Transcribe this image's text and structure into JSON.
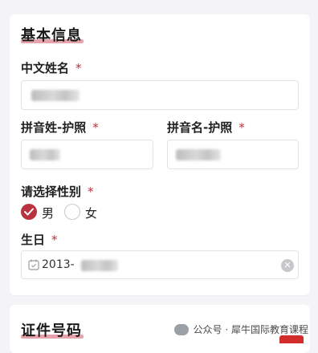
{
  "basic_info": {
    "title": "基本信息",
    "chinese_name": {
      "label": "中文姓名",
      "required": "*"
    },
    "pinyin_surname": {
      "label": "拼音姓-护照",
      "required": "*"
    },
    "pinyin_given": {
      "label": "拼音名-护照",
      "required": "*"
    },
    "gender": {
      "label": "请选择性别",
      "required": "*",
      "options": [
        "男",
        "女"
      ],
      "selected": "男"
    },
    "birthday": {
      "label": "生日",
      "required": "*",
      "value": "2013-"
    }
  },
  "id_section": {
    "title": "证件号码"
  },
  "watermark": {
    "text": "公众号 · 犀牛国际教育课程"
  },
  "colors": {
    "accent": "#b8323f",
    "underline": "#e7a3ab"
  },
  "icons": {
    "check": "check-icon",
    "calendar": "calendar-icon",
    "clear": "clear-icon",
    "wechat": "wechat-icon"
  }
}
